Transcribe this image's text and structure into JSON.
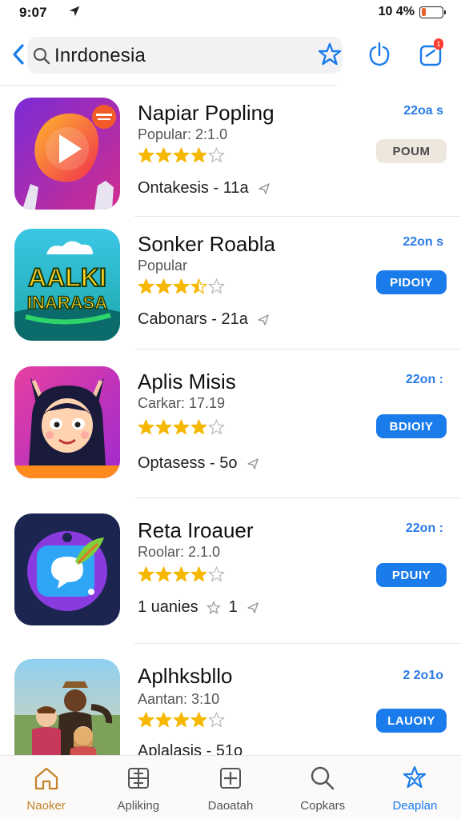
{
  "status_bar": {
    "time": "9:07",
    "battery_text": "10 4%",
    "battery_level": 0.2,
    "battery_color": "#e8622b"
  },
  "header": {
    "search_text": "Inrdonesia",
    "update_badge": "1"
  },
  "apps": [
    {
      "name": "Napiar Popling",
      "subtitle": "Popular: 2:1.0",
      "rating": 4,
      "meta_text": "Ontakesis - 11a",
      "size": "22oa s",
      "button": "POUM",
      "button_style": "beige",
      "icon": "video-play-icon"
    },
    {
      "name": "Sonker Roabla",
      "subtitle": "Popular",
      "rating": 3.5,
      "meta_text": "Cabonars - 21a",
      "size": "22on s",
      "button": "PIDOIY",
      "button_style": "blue",
      "icon": "aalki-logo-icon"
    },
    {
      "name": "Aplis Misis",
      "subtitle": "Carkar: 17.19",
      "rating": 4,
      "meta_text": "Optasess - 5o",
      "size": "22on :",
      "button": "BDIOIY",
      "button_style": "blue",
      "icon": "anime-character-icon"
    },
    {
      "name": "Reta Iroauer",
      "subtitle": "Roolar: 2.1.0",
      "rating": 4,
      "meta_text": "1 uanies",
      "meta_extra": "1",
      "size": "22on :",
      "button": "PDUIY",
      "button_style": "blue",
      "icon": "chat-bubble-leaf-icon"
    },
    {
      "name": "Aplhksbllo",
      "subtitle": "Aantan: 3:10",
      "rating": 4,
      "meta_text": "Aplalasis - 51o",
      "size": "2 2o1o",
      "button": "LAUOIY",
      "button_style": "blue",
      "icon": "people-photo-icon"
    }
  ],
  "tabs": [
    {
      "label": "Naoker",
      "icon": "home-icon"
    },
    {
      "label": "Apliking",
      "icon": "apps-grid-icon"
    },
    {
      "label": "Daoatah",
      "icon": "add-box-icon"
    },
    {
      "label": "Copkars",
      "icon": "search-icon"
    },
    {
      "label": "Deaplan",
      "icon": "star-badge-icon"
    }
  ],
  "colors": {
    "accent": "#1a7bea",
    "star": "#f5b700"
  }
}
